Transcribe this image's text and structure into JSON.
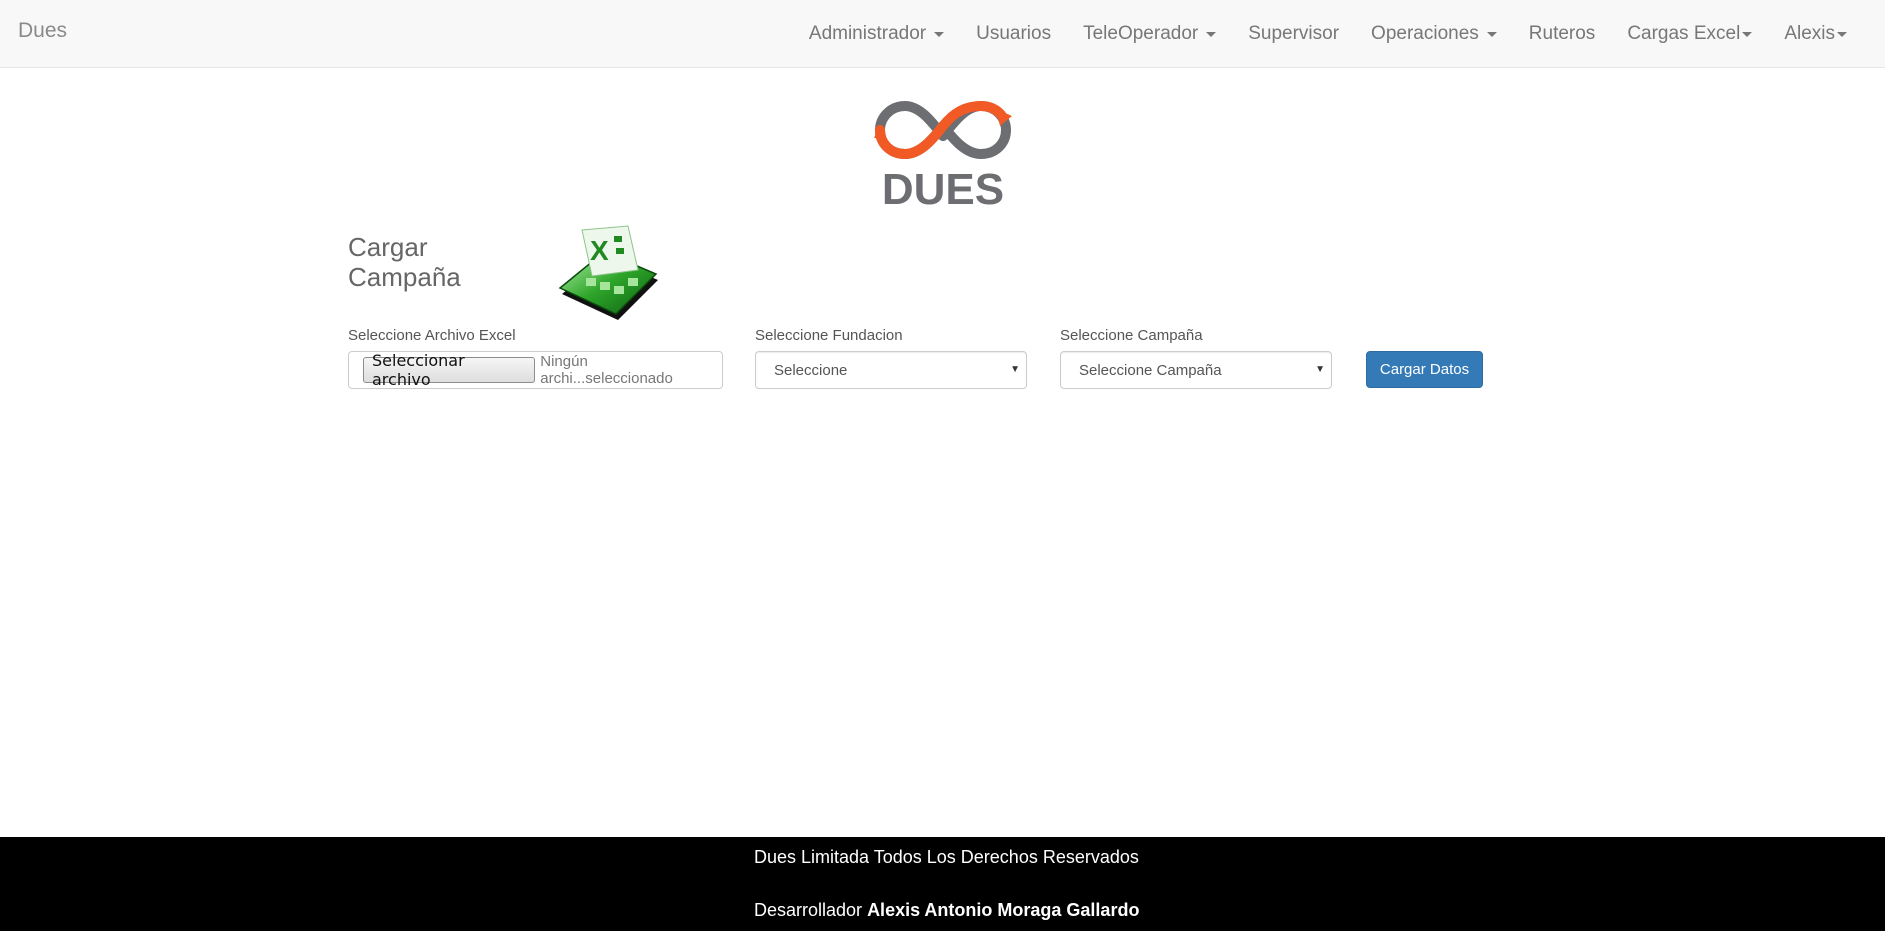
{
  "navbar": {
    "brand": "Dues",
    "items": [
      {
        "label": "Administrador",
        "dropdown": true
      },
      {
        "label": "Usuarios",
        "dropdown": false
      },
      {
        "label": "TeleOperador",
        "dropdown": true
      },
      {
        "label": "Supervisor",
        "dropdown": false
      },
      {
        "label": "Operaciones",
        "dropdown": true
      },
      {
        "label": "Ruteros",
        "dropdown": false
      },
      {
        "label": "Cargas Excel",
        "dropdown": true
      },
      {
        "label": "Alexis",
        "dropdown": true
      }
    ]
  },
  "logo": {
    "text": "DUES"
  },
  "page": {
    "title_line1": "Cargar",
    "title_line2": "Campaña",
    "excel_icon": "excel-icon"
  },
  "form": {
    "file_label": "Seleccione Archivo Excel",
    "file_button": "Seleccionar archivo",
    "file_status": "Ningún archi...seleccionado",
    "fundacion_label": "Seleccione Fundacion",
    "fundacion_value": "Seleccione",
    "campana_label": "Seleccione Campaña",
    "campana_value": "Seleccione Campaña",
    "submit": "Cargar Datos"
  },
  "footer": {
    "line1": "Dues Limitada Todos Los Derechos Reservados",
    "developer_prefix": "Desarrollador",
    "developer_name": "Alexis Antonio Moraga Gallardo"
  },
  "colors": {
    "primary": "#337ab7",
    "logo_orange": "#f15a24",
    "logo_gray": "#6d6e71",
    "footer_bg": "#000000"
  }
}
